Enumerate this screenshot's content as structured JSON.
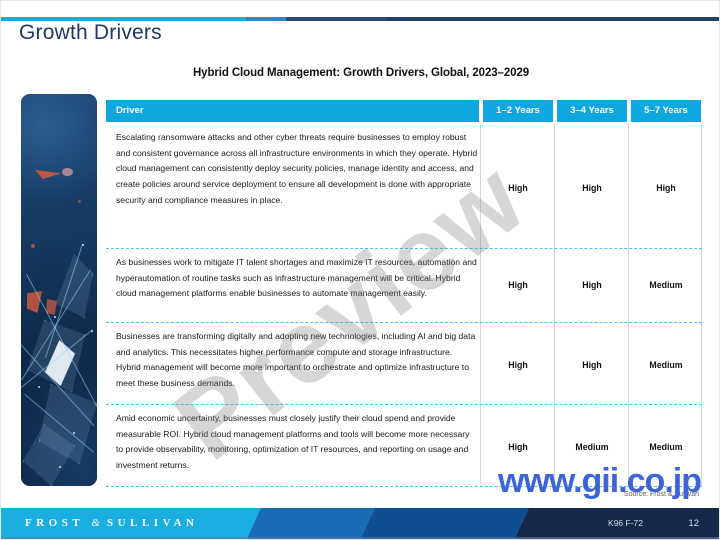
{
  "slide": {
    "title": "Growth Drivers",
    "exhibit_title": "Hybrid Cloud Management: Growth Drivers, Global, 2023–2029",
    "source_note": "Source: Frost & Sullivan",
    "accent_cyan": "#0fa7e0",
    "title_navy": "#1f3864",
    "footer_navy": "#15284a",
    "divider_blue": "#4bc3f0"
  },
  "table": {
    "headers": {
      "driver": "Driver",
      "col1": "1–2 Years",
      "col2": "3–4 Years",
      "col3": "5–7 Years"
    },
    "rows": [
      {
        "driver": "Escalating ransomware attacks and other cyber threats require businesses to employ robust and consistent governance across all infrastructure environments in which they operate. Hybrid cloud management can consistently deploy security policies, manage identity and access, and create policies around service deployment to ensure all development is done with appropriate security and compliance measures in place.",
        "y1_2": "High",
        "y3_4": "High",
        "y5_7": "High"
      },
      {
        "driver": "As businesses work to mitigate IT talent shortages and maximize IT resources, automation and hyperautomation of routine tasks such as infrastructure management will be critical. Hybrid cloud management platforms enable businesses to automate management easily.",
        "y1_2": "High",
        "y3_4": "High",
        "y5_7": "Medium"
      },
      {
        "driver": "Businesses are transforming digitally and adopting new technologies, including AI and big data and analytics. This necessitates higher performance compute and storage infrastructure. Hybrid management will become more important to orchestrate and optimize infrastructure to meet these business demands.",
        "y1_2": "High",
        "y3_4": "High",
        "y5_7": "Medium"
      },
      {
        "driver": "Amid economic uncertainty, businesses must closely justify their cloud spend and provide measurable ROI. Hybrid cloud management platforms and tools will become more necessary to provide observability, monitoring, optimization of IT resources, and reporting on usage and investment returns.",
        "y1_2": "High",
        "y3_4": "Medium",
        "y5_7": "Medium"
      }
    ]
  },
  "watermarks": {
    "preview": "Preview",
    "url": "www.gii.co.jp"
  },
  "footer": {
    "brand_left": "FROST",
    "brand_amp": "&",
    "brand_right": "SULLIVAN",
    "code": "K96 F-72",
    "page_number": "12"
  }
}
